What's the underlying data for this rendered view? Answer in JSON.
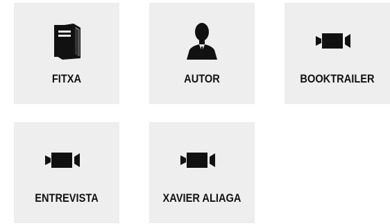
{
  "tiles": [
    {
      "label": "FITXA",
      "icon": "book-icon"
    },
    {
      "label": "AUTOR",
      "icon": "person-icon"
    },
    {
      "label": "BOOKTRAILER",
      "icon": "video-camera-icon"
    },
    {
      "label": "ENTREVISTA",
      "icon": "video-camera-icon"
    },
    {
      "label": "XAVIER ALIAGA",
      "icon": "video-camera-icon"
    }
  ],
  "colors": {
    "tile_background": "#eeeeee",
    "icon": "#111111",
    "label": "#111111",
    "page_background": "#ffffff"
  }
}
